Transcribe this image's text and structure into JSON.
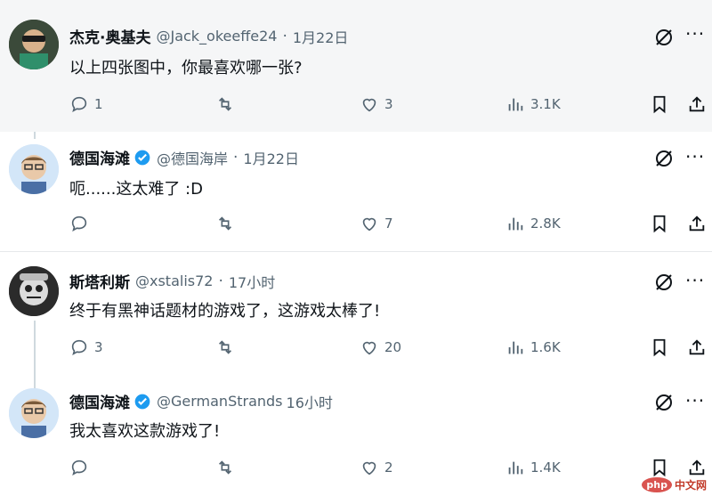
{
  "posts": [
    {
      "name": "杰克·奥基夫",
      "handle": "@Jack_okeeffe24",
      "time": "1月22日",
      "text": "以上四张图中，你最喜欢哪一张?",
      "replies": "1",
      "retweets": "",
      "likes": "3",
      "views": "3.1K",
      "verified": false
    },
    {
      "name": "德国海滩",
      "handle": "@德国海岸",
      "time": "1月22日",
      "text": "呃......这太难了 :D",
      "replies": "",
      "retweets": "",
      "likes": "7",
      "views": "2.8K",
      "verified": true
    },
    {
      "name": "斯塔利斯",
      "handle": "@xstalis72",
      "time": "17小时",
      "text": "终于有黑神话题材的游戏了，这游戏太棒了!",
      "replies": "3",
      "retweets": "",
      "likes": "20",
      "views": "1.6K",
      "verified": false
    },
    {
      "name": "德国海滩",
      "handle": "@GermanStrands",
      "time": "16小时",
      "text": "我太喜欢这款游戏了!",
      "replies": "",
      "retweets": "",
      "likes": "2",
      "views": "1.4K",
      "verified": true
    }
  ],
  "colors": {
    "verified": "#1d9bf0",
    "muted": "#536471",
    "thread": "#cfd9de"
  },
  "watermark": {
    "logo": "php",
    "text": "中文网"
  }
}
